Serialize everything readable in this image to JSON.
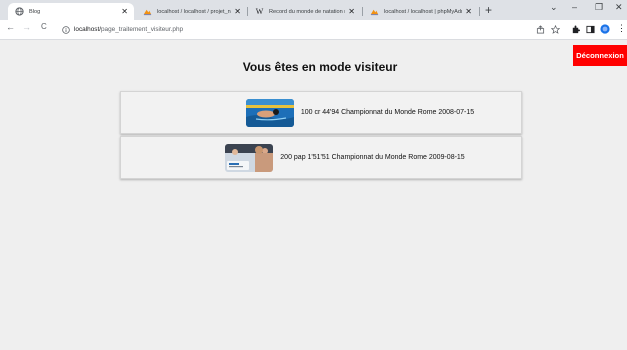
{
  "browser": {
    "tabs": [
      {
        "title": "Blog",
        "active": true
      },
      {
        "title": "localhost / localhost / projet_nat",
        "active": false
      },
      {
        "title": "Record du monde de natation m",
        "active": false
      },
      {
        "title": "localhost / localhost | phpMyAdm",
        "active": false
      }
    ],
    "new_tab_label": "+",
    "window_controls": {
      "dropdown": "⌄",
      "minimize": "–",
      "maximize": "❐",
      "close": "✕"
    },
    "nav": {
      "back": "←",
      "forward": "→",
      "reload": "C"
    },
    "url": {
      "host": "localhost/",
      "path": "page_traitement_visiteur.php"
    },
    "menu_label": "⋮"
  },
  "page": {
    "title": "Vous êtes en mode visiteur",
    "logout_label": "Déconnexion",
    "records": [
      {
        "text": "100 cr 44'94 Championnat du Monde Rome 2008-07-15",
        "thumb": "swimming-pool-photo"
      },
      {
        "text": "200 pap 1'51'51 Championnat du Monde Rome 2009-08-15",
        "thumb": "podium-photo"
      }
    ]
  },
  "colors": {
    "logout_bg": "#ff0000",
    "page_bg": "#efefef",
    "tabbar_bg": "#dee1e6"
  }
}
